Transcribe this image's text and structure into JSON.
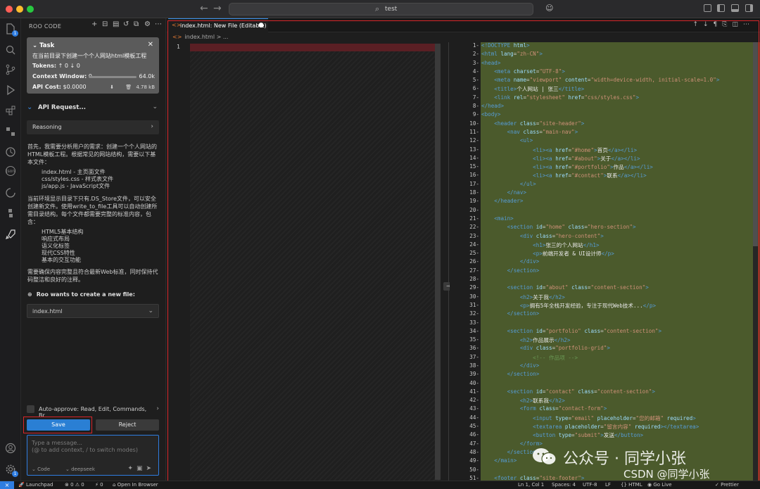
{
  "window": {
    "search_text": "test",
    "traffic": {
      "close": "#ff5f57",
      "min": "#febc2e",
      "max": "#28c840"
    }
  },
  "activity": {
    "explorer_badge": "1",
    "settings_badge": "1"
  },
  "sidebar": {
    "title": "ROO CODE",
    "task": {
      "header": "Task",
      "title": "在当前目录下创建一个个人网站html模板工程",
      "tokens_label": "Tokens:",
      "tokens_value": "↑ 0 ↓ 0",
      "context_label": "Context Window:",
      "context_value": "0",
      "context_max": "64.0k",
      "cost_label": "API Cost:",
      "cost_value": "$0.0000",
      "size": "4.78 kB"
    },
    "api_request": "API Request...",
    "reasoning": "Reasoning",
    "para1": "首先，我需要分析用户的需求：创建一个个人网站的\nHTML模板工程。根据常见的网站结构，需要以下基\n本文件：",
    "files_list": "index.html - 主页面文件\ncss/styles.css - 样式表文件\njs/app.js - JavaScript文件",
    "para2": "当前环境显示目录下只有.DS_Store文件，可以安全\n创建新文件。使用write_to_file工具可以自动创建所\n需目录结构。每个文件都需要完整的标准内容，包\n含：",
    "features_list": "HTML5基本结构\n响应式布局\n语义化标签\n现代CSS特性\n基本的交互功能",
    "para3": "需要确保内容完整且符合最新Web标准，同时保持代\n码整洁和良好的注释。",
    "create_file": "Roo wants to create a new file:",
    "file_name": "index.html",
    "auto_approve": "Auto-approve: Read, Edit, Commands, Br...",
    "save": "Save",
    "reject": "Reject",
    "chat_placeholder": "Type a message...\n(@ to add context, / to switch modes)",
    "mode": "Code",
    "model": "deepseek"
  },
  "editor": {
    "tab_title": "index.html: New File (Editable)",
    "breadcrumb": "index.html > ...",
    "left_line": "1",
    "code_lines": [
      [
        "1",
        "<!DOCTYPE html>"
      ],
      [
        "2",
        "<html lang=\"zh-CN\">"
      ],
      [
        "3",
        "<head>"
      ],
      [
        "4",
        "    <meta charset=\"UTF-8\">"
      ],
      [
        "5",
        "    <meta name=\"viewport\" content=\"width=device-width, initial-scale=1.0\">"
      ],
      [
        "6",
        "    <title>个人网站 | 张三</title>"
      ],
      [
        "7",
        "    <link rel=\"stylesheet\" href=\"css/styles.css\">"
      ],
      [
        "8",
        "</head>"
      ],
      [
        "9",
        "<body>"
      ],
      [
        "10",
        "    <header class=\"site-header\">"
      ],
      [
        "11",
        "        <nav class=\"main-nav\">"
      ],
      [
        "12",
        "            <ul>"
      ],
      [
        "13",
        "                <li><a href=\"#home\">首页</a></li>"
      ],
      [
        "14",
        "                <li><a href=\"#about\">关于</a></li>"
      ],
      [
        "15",
        "                <li><a href=\"#portfolio\">作品</a></li>"
      ],
      [
        "16",
        "                <li><a href=\"#contact\">联系</a></li>"
      ],
      [
        "17",
        "            </ul>"
      ],
      [
        "18",
        "        </nav>"
      ],
      [
        "19",
        "    </header>"
      ],
      [
        "20",
        ""
      ],
      [
        "21",
        "    <main>"
      ],
      [
        "22",
        "        <section id=\"home\" class=\"hero-section\">"
      ],
      [
        "23",
        "            <div class=\"hero-content\">"
      ],
      [
        "24",
        "                <h1>张三的个人网站</h1>"
      ],
      [
        "25",
        "                <p>前端开发者 & UI设计师</p>"
      ],
      [
        "26",
        "            </div>"
      ],
      [
        "27",
        "        </section>"
      ],
      [
        "28",
        ""
      ],
      [
        "29",
        "        <section id=\"about\" class=\"content-section\">"
      ],
      [
        "30",
        "            <h2>关于我</h2>"
      ],
      [
        "31",
        "            <p>拥有5年全栈开发经验，专注于现代Web技术...</p>"
      ],
      [
        "32",
        "        </section>"
      ],
      [
        "33",
        ""
      ],
      [
        "34",
        "        <section id=\"portfolio\" class=\"content-section\">"
      ],
      [
        "35",
        "            <h2>作品展示</h2>"
      ],
      [
        "36",
        "            <div class=\"portfolio-grid\">"
      ],
      [
        "37",
        "                <!-- 作品项 -->"
      ],
      [
        "38",
        "            </div>"
      ],
      [
        "39",
        "        </section>"
      ],
      [
        "40",
        ""
      ],
      [
        "41",
        "        <section id=\"contact\" class=\"content-section\">"
      ],
      [
        "42",
        "            <h2>联系我</h2>"
      ],
      [
        "43",
        "            <form class=\"contact-form\">"
      ],
      [
        "44",
        "                <input type=\"email\" placeholder=\"您的邮箱\" required>"
      ],
      [
        "45",
        "                <textarea placeholder=\"留言内容\" required></textarea>"
      ],
      [
        "46",
        "                <button type=\"submit\">发送</button>"
      ],
      [
        "47",
        "            </form>"
      ],
      [
        "48",
        "        </section>"
      ],
      [
        "49",
        "    </main>"
      ],
      [
        "50",
        ""
      ],
      [
        "51",
        "    <footer class=\"site-footer\">"
      ]
    ]
  },
  "watermark": {
    "line1": "公众号 · 同学小张",
    "line2": "CSDN @同学小张"
  },
  "statusbar": {
    "launchpad": "Launchpad",
    "problems": "⊗ 0 ⚠ 0",
    "ports": "⚡ 0",
    "open_browser": "Open In Browser",
    "position": "Ln 1, Col 1",
    "spaces": "Spaces: 4",
    "encoding": "UTF-8",
    "eol": "LF",
    "language": "HTML",
    "golive": "Go Live",
    "prettier": "Prettier"
  }
}
